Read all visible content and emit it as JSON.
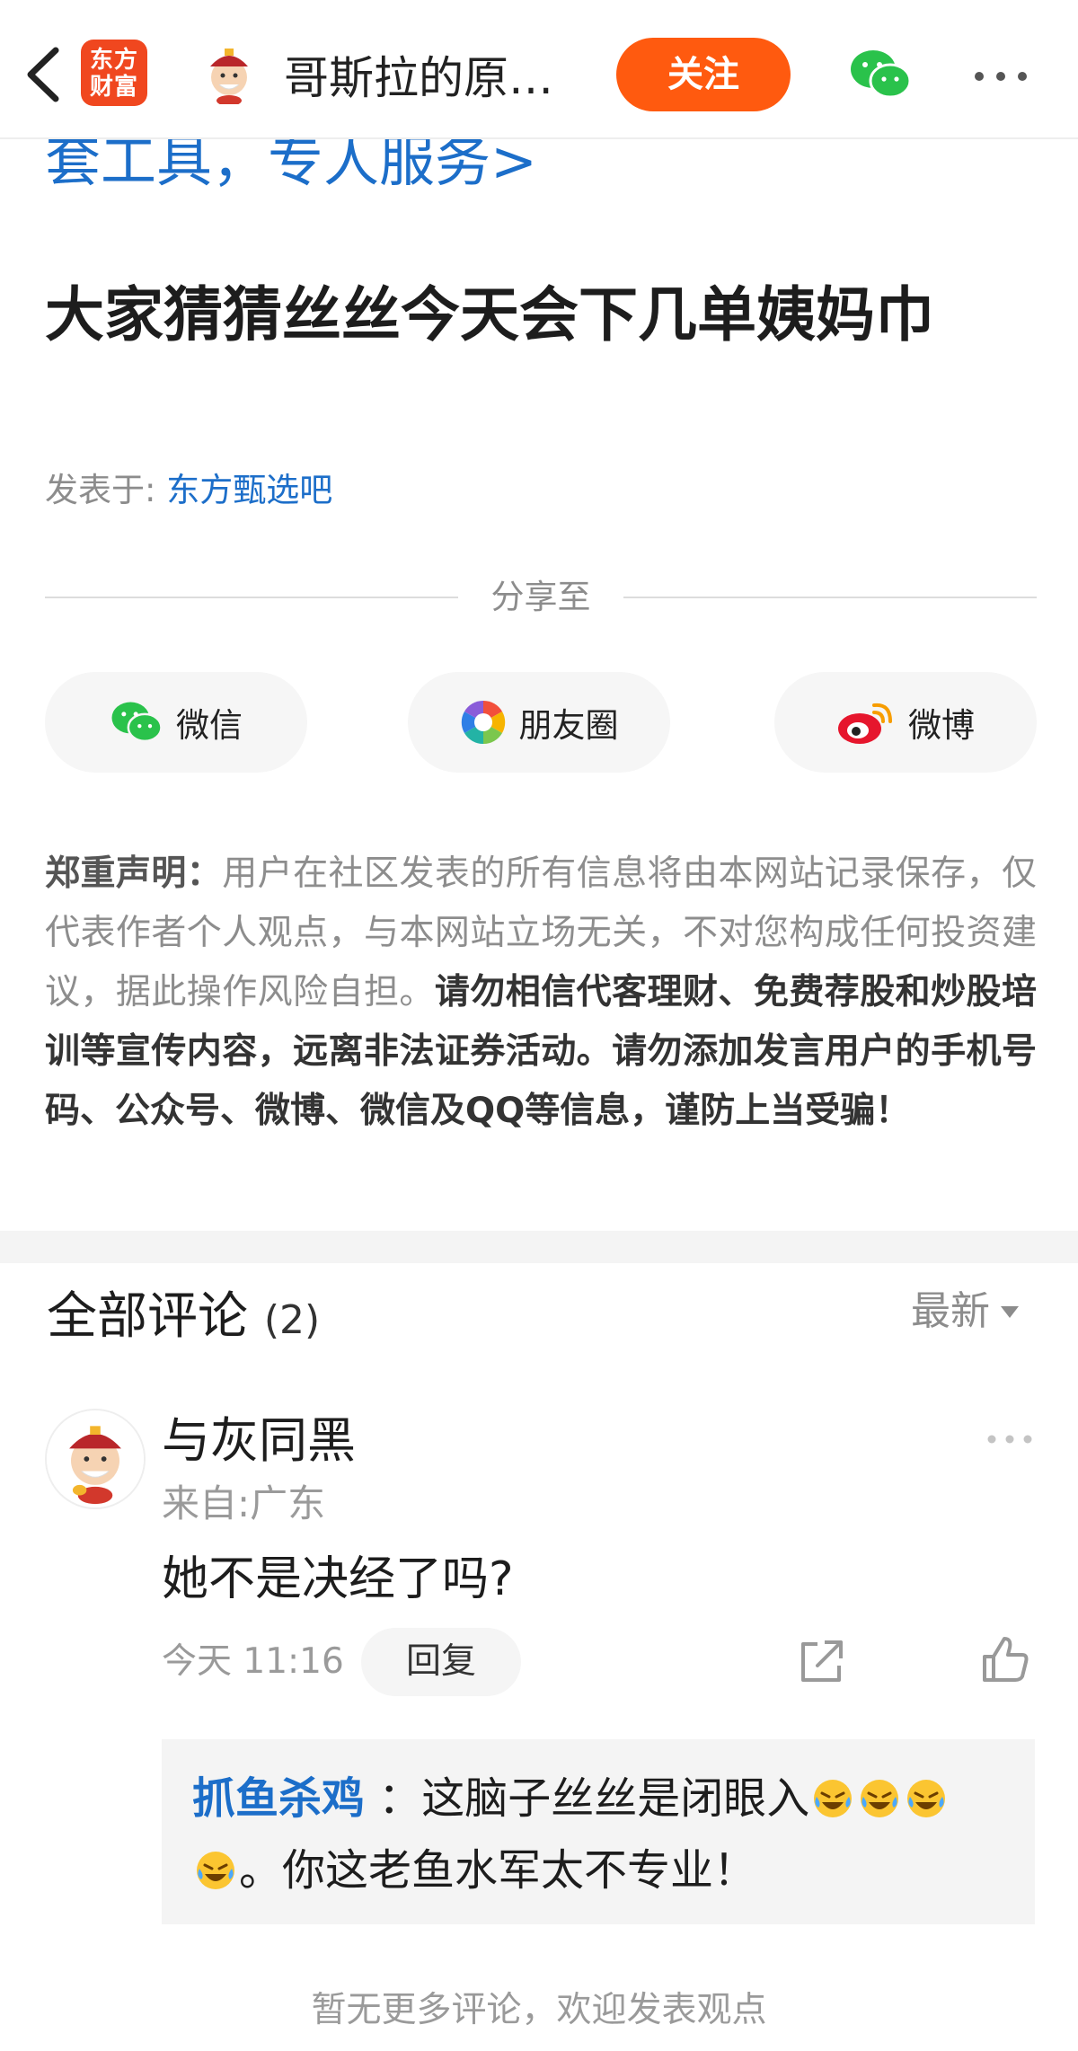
{
  "header": {
    "logo_line1": "东方",
    "logo_line2": "财富",
    "title": "哥斯拉的原…",
    "follow_label": "关注"
  },
  "article": {
    "promo_link": "套工具，专人服务>",
    "title": "大家猜猜丝丝今天会下几单姨妈巾",
    "posted_in_label": "发表于: ",
    "posted_in_forum": "东方甄选吧"
  },
  "share": {
    "label": "分享至",
    "targets": [
      {
        "label": "微信",
        "icon": "wechat-icon"
      },
      {
        "label": "朋友圈",
        "icon": "moments-icon"
      },
      {
        "label": "微博",
        "icon": "weibo-icon"
      }
    ]
  },
  "disclaimer": {
    "heading": "郑重声明：",
    "normal_text": "用户在社区发表的所有信息将由本网站记录保存，仅代表作者个人观点，与本网站立场无关，不对您构成任何投资建议，据此操作风险自担。",
    "bold_text": "请勿相信代客理财、免费荐股和炒股培训等宣传内容，远离非法证券活动。请勿添加发言用户的手机号码、公众号、微博、微信及QQ等信息，谨防上当受骗！"
  },
  "comments": {
    "title": "全部评论",
    "count": "(2)",
    "sort_label": "最新",
    "items": [
      {
        "user": "与灰同黑",
        "location": "来自:广东",
        "text": "她不是决经了吗?",
        "time": "今天 11:16",
        "reply_label": "回复",
        "reply": {
          "user": "抓鱼杀鸡",
          "separator": " ：",
          "text_before": "这脑子丝丝是闭眼入",
          "text_after": "。你这老鱼水军太不专业！",
          "emoji": "laughing-crying-emoji"
        }
      }
    ],
    "no_more": "暂无更多评论，欢迎发表观点"
  },
  "colors": {
    "accent_orange": "#ff5a0f",
    "link_blue": "#1c6ec9",
    "logo_red": "#f0471f"
  }
}
